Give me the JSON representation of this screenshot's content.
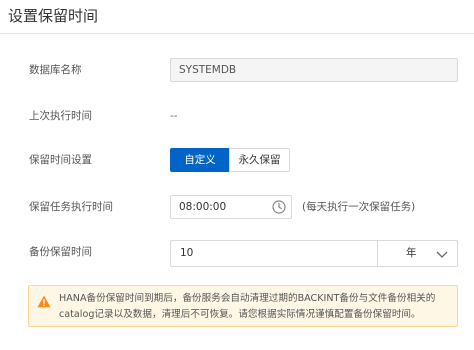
{
  "dialog": {
    "title": "设置保留时间"
  },
  "fields": {
    "db_name": {
      "label": "数据库名称",
      "value": "SYSTEMDB"
    },
    "last_run": {
      "label": "上次执行时间",
      "value": "--"
    },
    "retention_setting": {
      "label": "保留时间设置",
      "options": [
        "自定义",
        "永久保留"
      ],
      "selected": "自定义"
    },
    "task_time": {
      "label": "保留任务执行时间",
      "value": "08:00:00",
      "hint": "(每天执行一次保留任务)"
    },
    "backup_retention": {
      "label": "备份保留时间",
      "value": "10",
      "unit": "年"
    }
  },
  "warning": {
    "text": "HANA备份保留时间到期后，备份服务会自动清理过期的BACKINT备份与文件备份相关的catalog记录以及数据，清理后不可恢复。请您根据实际情况谨慎配置备份保留时间。",
    "color": "#fa8c16"
  },
  "colors": {
    "accent": "#0064c8",
    "warning_bg": "#fff7e6",
    "warning_border": "#ffd591"
  }
}
